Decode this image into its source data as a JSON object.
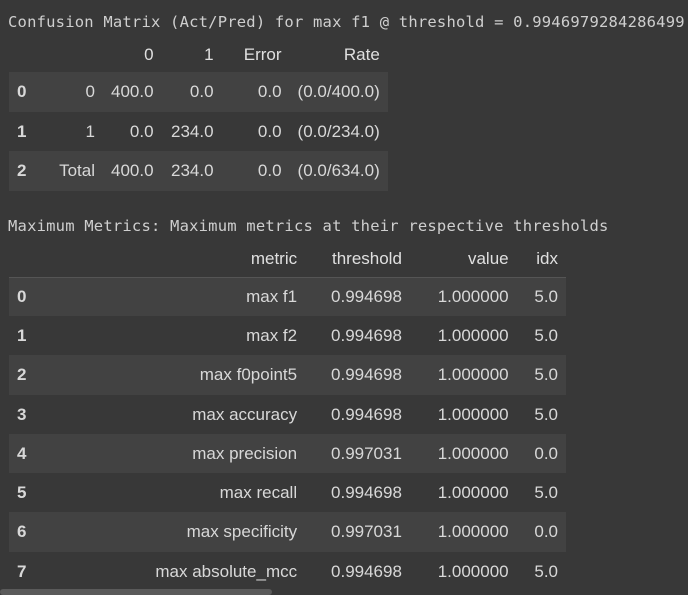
{
  "confusion": {
    "title": "Confusion Matrix (Act/Pred) for max f1 @ threshold = 0.9946979284286499:",
    "headers": [
      "",
      "",
      "0",
      "1",
      "Error",
      "Rate"
    ],
    "rows": [
      [
        "0",
        "0",
        "400.0",
        "0.0",
        "0.0",
        "(0.0/400.0)"
      ],
      [
        "1",
        "1",
        "0.0",
        "234.0",
        "0.0",
        "(0.0/234.0)"
      ],
      [
        "2",
        "Total",
        "400.0",
        "234.0",
        "0.0",
        "(0.0/634.0)"
      ]
    ]
  },
  "metrics": {
    "title": "Maximum Metrics: Maximum metrics at their respective thresholds",
    "headers": [
      "",
      "metric",
      "threshold",
      "value",
      "idx"
    ],
    "rows": [
      [
        "0",
        "max f1",
        "0.994698",
        "1.000000",
        "5.0"
      ],
      [
        "1",
        "max f2",
        "0.994698",
        "1.000000",
        "5.0"
      ],
      [
        "2",
        "max f0point5",
        "0.994698",
        "1.000000",
        "5.0"
      ],
      [
        "3",
        "max accuracy",
        "0.994698",
        "1.000000",
        "5.0"
      ],
      [
        "4",
        "max precision",
        "0.997031",
        "1.000000",
        "0.0"
      ],
      [
        "5",
        "max recall",
        "0.994698",
        "1.000000",
        "5.0"
      ],
      [
        "6",
        "max specificity",
        "0.997031",
        "1.000000",
        "0.0"
      ],
      [
        "7",
        "max absolute_mcc",
        "0.994698",
        "1.000000",
        "5.0"
      ]
    ]
  }
}
